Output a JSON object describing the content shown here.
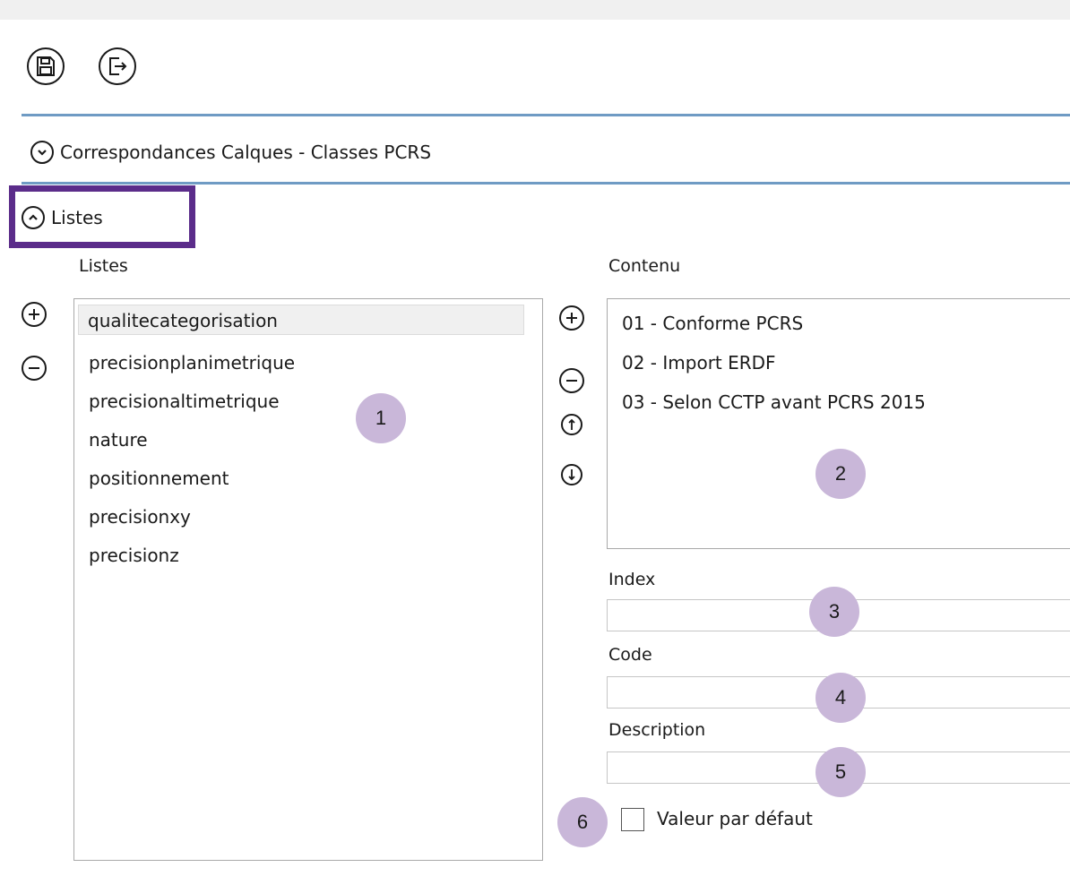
{
  "toolbar": {
    "save_icon": "save-icon",
    "exit_icon": "exit-icon"
  },
  "sections": {
    "correspondances": {
      "label": "Correspondances Calques - Classes PCRS",
      "state": "collapsed"
    },
    "listes": {
      "label": "Listes",
      "state": "expanded"
    }
  },
  "lists_panel": {
    "header": "Listes",
    "items": [
      "qualitecategorisation",
      "precisionplanimetrique",
      "precisionaltimetrique",
      "nature",
      "positionnement",
      "precisionxy",
      "precisionz"
    ],
    "selected_index": 0
  },
  "content_panel": {
    "header": "Contenu",
    "items": [
      "01 - Conforme PCRS",
      "02 - Import ERDF",
      "03 - Selon CCTP avant PCRS 2015"
    ]
  },
  "fields": {
    "index_label": "Index",
    "index_value": "",
    "code_label": "Code",
    "code_value": "",
    "description_label": "Description",
    "description_value": ""
  },
  "checkbox": {
    "label": "Valeur par défaut",
    "checked": false
  },
  "callouts": [
    "1",
    "2",
    "3",
    "4",
    "5",
    "6"
  ],
  "colors": {
    "accent_line": "#6f9bc4",
    "highlight_border": "#5b2c8a",
    "callout_fill": "#c9b7d9"
  }
}
